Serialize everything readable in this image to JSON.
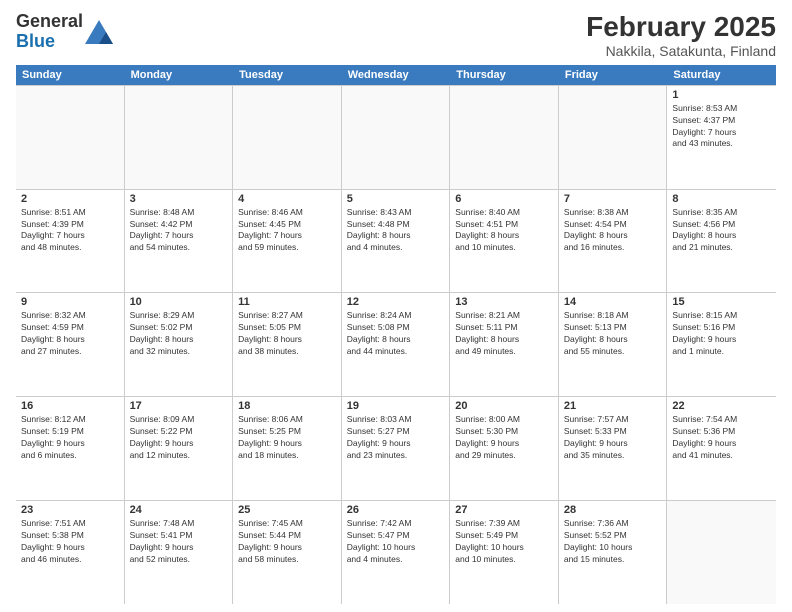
{
  "header": {
    "logo_general": "General",
    "logo_blue": "Blue",
    "month_title": "February 2025",
    "location": "Nakkila, Satakunta, Finland"
  },
  "calendar": {
    "days_of_week": [
      "Sunday",
      "Monday",
      "Tuesday",
      "Wednesday",
      "Thursday",
      "Friday",
      "Saturday"
    ],
    "rows": [
      [
        {
          "day": "",
          "info": ""
        },
        {
          "day": "",
          "info": ""
        },
        {
          "day": "",
          "info": ""
        },
        {
          "day": "",
          "info": ""
        },
        {
          "day": "",
          "info": ""
        },
        {
          "day": "",
          "info": ""
        },
        {
          "day": "1",
          "info": "Sunrise: 8:53 AM\nSunset: 4:37 PM\nDaylight: 7 hours\nand 43 minutes."
        }
      ],
      [
        {
          "day": "2",
          "info": "Sunrise: 8:51 AM\nSunset: 4:39 PM\nDaylight: 7 hours\nand 48 minutes."
        },
        {
          "day": "3",
          "info": "Sunrise: 8:48 AM\nSunset: 4:42 PM\nDaylight: 7 hours\nand 54 minutes."
        },
        {
          "day": "4",
          "info": "Sunrise: 8:46 AM\nSunset: 4:45 PM\nDaylight: 7 hours\nand 59 minutes."
        },
        {
          "day": "5",
          "info": "Sunrise: 8:43 AM\nSunset: 4:48 PM\nDaylight: 8 hours\nand 4 minutes."
        },
        {
          "day": "6",
          "info": "Sunrise: 8:40 AM\nSunset: 4:51 PM\nDaylight: 8 hours\nand 10 minutes."
        },
        {
          "day": "7",
          "info": "Sunrise: 8:38 AM\nSunset: 4:54 PM\nDaylight: 8 hours\nand 16 minutes."
        },
        {
          "day": "8",
          "info": "Sunrise: 8:35 AM\nSunset: 4:56 PM\nDaylight: 8 hours\nand 21 minutes."
        }
      ],
      [
        {
          "day": "9",
          "info": "Sunrise: 8:32 AM\nSunset: 4:59 PM\nDaylight: 8 hours\nand 27 minutes."
        },
        {
          "day": "10",
          "info": "Sunrise: 8:29 AM\nSunset: 5:02 PM\nDaylight: 8 hours\nand 32 minutes."
        },
        {
          "day": "11",
          "info": "Sunrise: 8:27 AM\nSunset: 5:05 PM\nDaylight: 8 hours\nand 38 minutes."
        },
        {
          "day": "12",
          "info": "Sunrise: 8:24 AM\nSunset: 5:08 PM\nDaylight: 8 hours\nand 44 minutes."
        },
        {
          "day": "13",
          "info": "Sunrise: 8:21 AM\nSunset: 5:11 PM\nDaylight: 8 hours\nand 49 minutes."
        },
        {
          "day": "14",
          "info": "Sunrise: 8:18 AM\nSunset: 5:13 PM\nDaylight: 8 hours\nand 55 minutes."
        },
        {
          "day": "15",
          "info": "Sunrise: 8:15 AM\nSunset: 5:16 PM\nDaylight: 9 hours\nand 1 minute."
        }
      ],
      [
        {
          "day": "16",
          "info": "Sunrise: 8:12 AM\nSunset: 5:19 PM\nDaylight: 9 hours\nand 6 minutes."
        },
        {
          "day": "17",
          "info": "Sunrise: 8:09 AM\nSunset: 5:22 PM\nDaylight: 9 hours\nand 12 minutes."
        },
        {
          "day": "18",
          "info": "Sunrise: 8:06 AM\nSunset: 5:25 PM\nDaylight: 9 hours\nand 18 minutes."
        },
        {
          "day": "19",
          "info": "Sunrise: 8:03 AM\nSunset: 5:27 PM\nDaylight: 9 hours\nand 23 minutes."
        },
        {
          "day": "20",
          "info": "Sunrise: 8:00 AM\nSunset: 5:30 PM\nDaylight: 9 hours\nand 29 minutes."
        },
        {
          "day": "21",
          "info": "Sunrise: 7:57 AM\nSunset: 5:33 PM\nDaylight: 9 hours\nand 35 minutes."
        },
        {
          "day": "22",
          "info": "Sunrise: 7:54 AM\nSunset: 5:36 PM\nDaylight: 9 hours\nand 41 minutes."
        }
      ],
      [
        {
          "day": "23",
          "info": "Sunrise: 7:51 AM\nSunset: 5:38 PM\nDaylight: 9 hours\nand 46 minutes."
        },
        {
          "day": "24",
          "info": "Sunrise: 7:48 AM\nSunset: 5:41 PM\nDaylight: 9 hours\nand 52 minutes."
        },
        {
          "day": "25",
          "info": "Sunrise: 7:45 AM\nSunset: 5:44 PM\nDaylight: 9 hours\nand 58 minutes."
        },
        {
          "day": "26",
          "info": "Sunrise: 7:42 AM\nSunset: 5:47 PM\nDaylight: 10 hours\nand 4 minutes."
        },
        {
          "day": "27",
          "info": "Sunrise: 7:39 AM\nSunset: 5:49 PM\nDaylight: 10 hours\nand 10 minutes."
        },
        {
          "day": "28",
          "info": "Sunrise: 7:36 AM\nSunset: 5:52 PM\nDaylight: 10 hours\nand 15 minutes."
        },
        {
          "day": "",
          "info": ""
        }
      ]
    ]
  }
}
